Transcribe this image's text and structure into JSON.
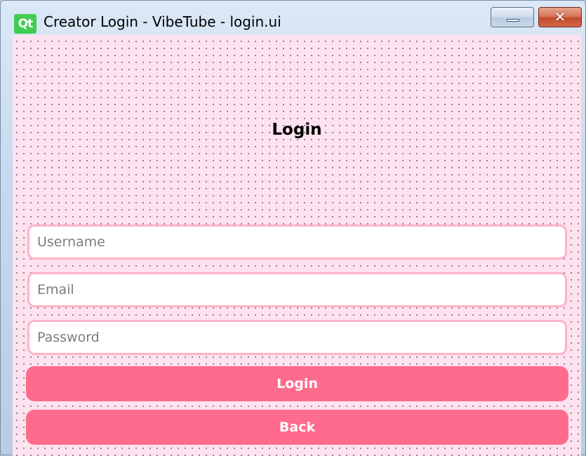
{
  "window": {
    "title": "Creator Login - VibeTube - login.ui",
    "logo_text": "Qt",
    "minimize_icon": "minimize-icon",
    "close_icon": "close-icon",
    "close_glyph": "✕"
  },
  "form": {
    "heading": "Login",
    "username": {
      "value": "",
      "placeholder": "Username"
    },
    "email": {
      "value": "",
      "placeholder": "Email"
    },
    "password": {
      "value": "",
      "placeholder": "Password"
    },
    "login_label": "Login",
    "back_label": "Back"
  },
  "colors": {
    "background": "#fde3ef",
    "field_border": "#ffb3c6",
    "button": "#ff6b8c",
    "button_text": "#ffffff"
  }
}
